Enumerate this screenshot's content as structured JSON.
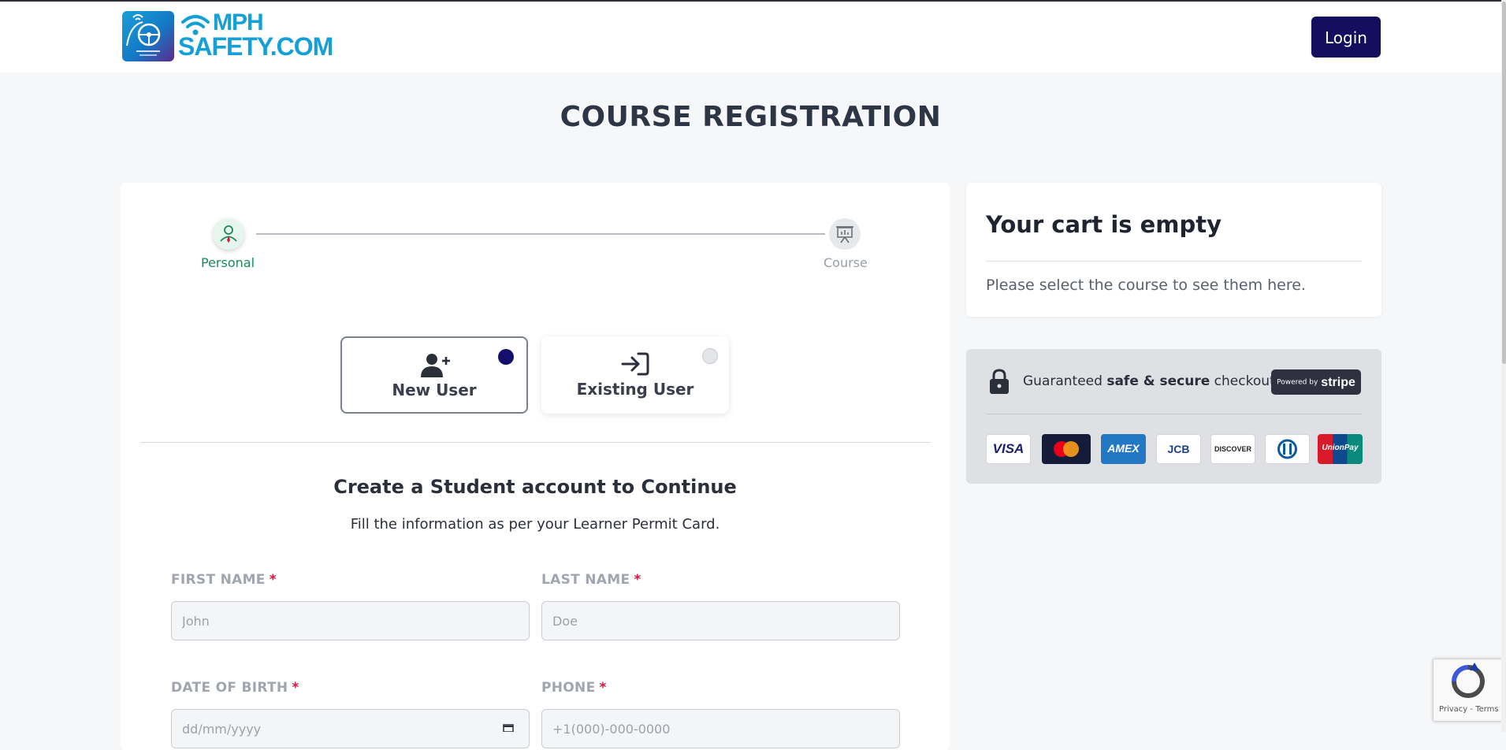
{
  "header": {
    "logo_line1": "MPH",
    "logo_line2": "SAFETY.COM",
    "login_label": "Login"
  },
  "page_title": "COURSE REGISTRATION",
  "stepper": {
    "steps": [
      {
        "label": "Personal",
        "state": "active"
      },
      {
        "label": "Course",
        "state": "inactive"
      }
    ]
  },
  "user_type": {
    "options": [
      {
        "label": "New User",
        "selected": true
      },
      {
        "label": "Existing User",
        "selected": false
      }
    ]
  },
  "form": {
    "title": "Create a Student account to Continue",
    "subtitle": "Fill the information as per your Learner Permit Card.",
    "required_marker": "*",
    "first_name": {
      "label": "FIRST NAME",
      "placeholder": "John",
      "value": ""
    },
    "last_name": {
      "label": "LAST NAME",
      "placeholder": "Doe",
      "value": ""
    },
    "dob": {
      "label": "DATE OF BIRTH",
      "placeholder": "dd/mm/yyyy",
      "value": ""
    },
    "phone": {
      "label": "PHONE",
      "placeholder": "+1(000)-000-0000",
      "value": ""
    }
  },
  "cart": {
    "title": "Your cart is empty",
    "message": "Please select the course to see them here."
  },
  "secure": {
    "text_prefix": "Guaranteed ",
    "text_bold": "safe & secure",
    "text_suffix": " checkout",
    "stripe_powered": "Powered by",
    "stripe_name": "stripe",
    "payment_methods": [
      "VISA",
      "mastercard",
      "AMEX",
      "JCB",
      "DISCOVER",
      "diners club",
      "UnionPay"
    ]
  },
  "recaptcha": {
    "privacy": "Privacy",
    "separator": " - ",
    "terms": "Terms"
  },
  "colors": {
    "brand_navy": "#130f5e",
    "brand_cyan": "#14a0d6",
    "active_step": "#1a8a5a",
    "required": "#e0113b"
  }
}
